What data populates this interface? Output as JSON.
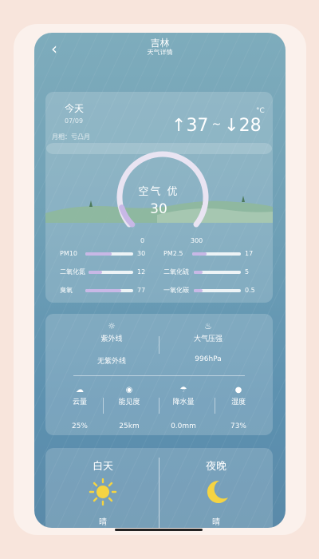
{
  "header": {
    "city": "吉林",
    "subtitle": "天气详情"
  },
  "today": {
    "label": "今天",
    "date": "07/09",
    "moon_phase": "月相：亏凸月",
    "high": "37",
    "low": "28",
    "unit": "°C",
    "tilde": "~"
  },
  "air": {
    "title": "空气 优",
    "aqi": "30",
    "aqi_numeric": 30,
    "scale_min": "0",
    "scale_max": "300",
    "pollutants": [
      {
        "name": "PM10",
        "value": "30",
        "fill": 0.55
      },
      {
        "name": "PM2.5",
        "value": "17",
        "fill": 0.3
      },
      {
        "name": "二氧化氮",
        "value": "12",
        "fill": 0.3
      },
      {
        "name": "二氧化硫",
        "value": "5",
        "fill": 0.18
      },
      {
        "name": "臭氧",
        "value": "77",
        "fill": 0.75
      },
      {
        "name": "一氧化碳",
        "value": "0.5",
        "fill": 0.18
      }
    ]
  },
  "info": {
    "uv": {
      "icon": "sun-outline-icon",
      "label": "紫外线",
      "value": "无紫外线"
    },
    "pressure": {
      "icon": "pressure-icon",
      "label": "大气压强",
      "value": "996hPa"
    },
    "stats": [
      {
        "icon": "cloud-icon",
        "label": "云量",
        "value": "25%"
      },
      {
        "icon": "eye-icon",
        "label": "能见度",
        "value": "25km"
      },
      {
        "icon": "rain-icon",
        "label": "降水量",
        "value": "0.0mm"
      },
      {
        "icon": "drop-icon",
        "label": "湿度",
        "value": "73%"
      }
    ]
  },
  "daynight": {
    "day": {
      "label": "白天",
      "icon": "sun-icon",
      "condition": "晴"
    },
    "night": {
      "label": "夜晚",
      "icon": "moon-icon",
      "condition": "晴"
    }
  },
  "colors": {
    "bg": "#f8e5dc",
    "phone_top": "#7eacbc",
    "phone_bottom": "#5a8aa9",
    "gauge_track": "#e9e4f2",
    "gauge_fill": "#c8b8e6",
    "sun": "#f5d442"
  }
}
